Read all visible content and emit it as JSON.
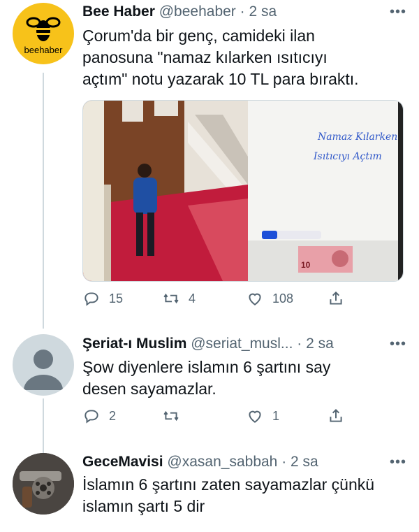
{
  "tweets": [
    {
      "name": "Bee Haber",
      "handle": "@beehaber",
      "time": "2 sa",
      "avatar_text": "beehaber",
      "text_lines": [
        "Çorum'da bir genç, camideki ilan",
        "panosuna \"namaz kılarken ısıtıcıyı",
        "açtım\" notu yazarak 10 TL para bıraktı."
      ],
      "media_note_lines": [
        "Namaz Kılarken",
        "Isıtıcıyı Açtım"
      ],
      "banknote_value": "10",
      "replies": "15",
      "retweets": "4",
      "likes": "108"
    },
    {
      "name": "Şeriat-ı Muslim",
      "handle": "@seriat_musl...",
      "time": "2 sa",
      "text_lines": [
        "Şow diyenlere islamın 6 şartını say",
        "desen sayamazlar."
      ],
      "replies": "2",
      "retweets": "",
      "likes": "1"
    },
    {
      "name": "GeceMavisi",
      "handle": "@xasan_sabbah",
      "time": "2 sa",
      "text_lines": [
        "İslamın 6 şartını zaten sayamazlar çünkü",
        "islamın şartı 5 dir"
      ]
    }
  ],
  "separator": "·",
  "icons": [
    "reply-icon",
    "retweet-icon",
    "like-icon",
    "share-icon",
    "more-icon"
  ],
  "colors": {
    "brand_yellow": "#f7c21a",
    "text": "#0f1419",
    "secondary": "#536471",
    "line": "#cfd9de"
  }
}
